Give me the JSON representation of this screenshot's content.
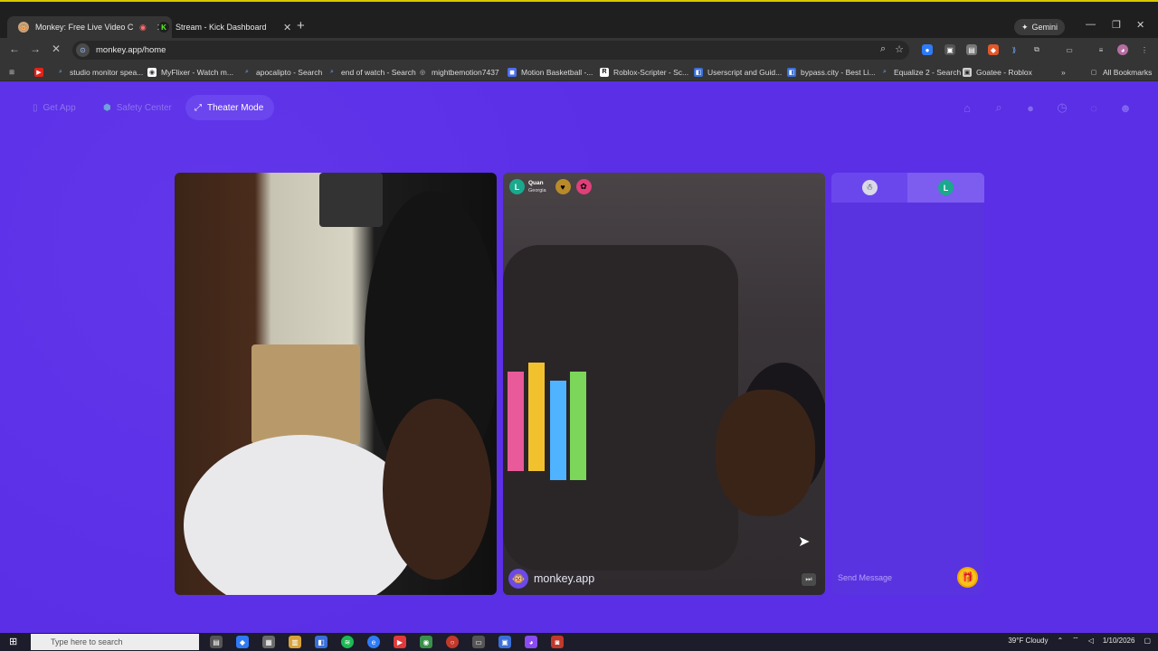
{
  "browser": {
    "tabs": [
      {
        "title": "Monkey: Free Live Video Ch",
        "favicon": "monkey-icon",
        "active": true,
        "recording_icon": "record-icon"
      },
      {
        "title": "Stream - Kick Dashboard",
        "favicon": "kick-icon",
        "active": false
      }
    ],
    "gemini_label": "Gemini",
    "address": "monkey.app/home",
    "bookmarks": [
      "studio monitor spea...",
      "MyFlixer - Watch m...",
      "apocalipto - Search",
      "end of watch - Search",
      "mightbemotion7437",
      "Motion Basketball -...",
      "Roblox-Scripter - Sc...",
      "Userscript and Guid...",
      "bypass.city - Best Li...",
      "Equalize 2 - Search",
      "Goatee - Roblox"
    ],
    "all_bookmarks_label": "All Bookmarks"
  },
  "page": {
    "nav": {
      "get_app": "Get App",
      "safety_center": "Safety Center",
      "theater_mode": "Theater Mode"
    },
    "top_icons": [
      "store-icon",
      "search-icon",
      "coin-icon",
      "history-icon",
      "chat-icon",
      "profile-icon"
    ],
    "remote_user": {
      "initial": "L",
      "name": "Quan",
      "location": "Georgia"
    },
    "watermark": "monkey.app",
    "chat": {
      "peer_initial": "L",
      "placeholder": "Send Message"
    }
  },
  "taskbar": {
    "search_placeholder": "Type here to search",
    "weather": "39°F Cloudy",
    "date": "1/10/2026"
  },
  "colors": {
    "page_bg": "#5b2fe6",
    "chat_bg": "#5a33e0",
    "avatar_green": "#1aa98d",
    "gift_yellow": "#f6c21c"
  }
}
